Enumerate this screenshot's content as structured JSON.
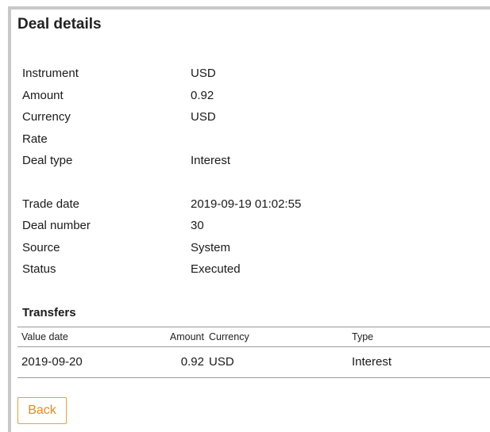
{
  "page": {
    "title": "Deal details"
  },
  "details": [
    {
      "label": "Instrument",
      "value": "USD"
    },
    {
      "label": "Amount",
      "value": "0.92"
    },
    {
      "label": "Currency",
      "value": "USD"
    },
    {
      "label": "Rate",
      "value": ""
    },
    {
      "label": "Deal type",
      "value": "Interest"
    }
  ],
  "details2": [
    {
      "label": "Trade date",
      "value": "2019-09-19 01:02:55"
    },
    {
      "label": "Deal number",
      "value": "30"
    },
    {
      "label": "Source",
      "value": "System"
    },
    {
      "label": "Status",
      "value": "Executed"
    }
  ],
  "transfers": {
    "title": "Transfers",
    "columns": {
      "value_date": "Value date",
      "amount": "Amount",
      "currency": "Currency",
      "type": "Type"
    },
    "rows": [
      {
        "value_date": "2019-09-20",
        "amount": "0.92",
        "currency": "USD",
        "type": "Interest"
      }
    ]
  },
  "actions": {
    "back_label": "Back"
  },
  "colors": {
    "accent": "#f0a030",
    "border": "#c8c8c8"
  }
}
